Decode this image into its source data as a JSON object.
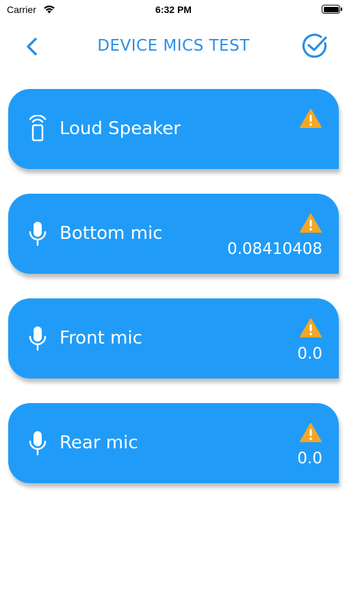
{
  "status_bar": {
    "carrier": "Carrier",
    "time": "6:32 PM"
  },
  "nav": {
    "title": "DEVICE MICS TEST",
    "back_icon": "chevron-left-icon",
    "done_icon": "check-circle-icon",
    "accent": "#2c8ee6"
  },
  "cards": [
    {
      "label": "Loud Speaker",
      "icon": "speaker-icon",
      "status_icon": "warning-icon",
      "value": ""
    },
    {
      "label": "Bottom mic",
      "icon": "microphone-icon",
      "status_icon": "warning-icon",
      "value": "0.08410408"
    },
    {
      "label": "Front mic",
      "icon": "microphone-icon",
      "status_icon": "warning-icon",
      "value": "0.0"
    },
    {
      "label": "Rear mic",
      "icon": "microphone-icon",
      "status_icon": "warning-icon",
      "value": "0.0"
    }
  ],
  "colors": {
    "card_background": "#209cf8",
    "warning": "#f5a623"
  }
}
